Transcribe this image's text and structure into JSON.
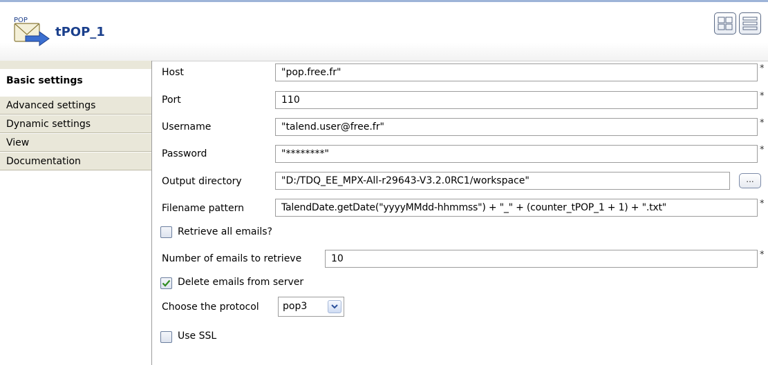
{
  "component": {
    "icon_text": "POP",
    "icon": "pop-mail-icon",
    "title": "tPOP_1"
  },
  "view_buttons": [
    {
      "icon": "grid-view-icon"
    },
    {
      "icon": "list-view-icon"
    }
  ],
  "sidebar": {
    "items": [
      {
        "label": "Basic settings",
        "active": true
      },
      {
        "label": "Advanced settings"
      },
      {
        "label": "Dynamic settings"
      },
      {
        "label": "View"
      },
      {
        "label": "Documentation"
      }
    ]
  },
  "form": {
    "required_mark": "*",
    "host": {
      "label": "Host",
      "value": "\"pop.free.fr\""
    },
    "port": {
      "label": "Port",
      "value": "110"
    },
    "username": {
      "label": "Username",
      "value": "\"talend.user@free.fr\""
    },
    "password": {
      "label": "Password",
      "value": "\"********\""
    },
    "output_directory": {
      "label": "Output directory",
      "value": "\"D:/TDQ_EE_MPX-All-r29643-V3.2.0RC1/workspace\"",
      "browse_label": "..."
    },
    "filename_pattern": {
      "label": "Filename pattern",
      "value": "TalendDate.getDate(\"yyyyMMdd-hhmmss\") + \"_\" + (counter_tPOP_1 + 1) + \".txt\""
    },
    "retrieve_all": {
      "label": "Retrieve all emails?",
      "checked": false
    },
    "number_of_emails": {
      "label": "Number of emails to retrieve",
      "value": "10"
    },
    "delete_emails": {
      "label": "Delete emails from server",
      "checked": true
    },
    "protocol": {
      "label": "Choose the protocol",
      "value": "pop3"
    },
    "use_ssl": {
      "label": "Use SSL",
      "checked": false
    }
  },
  "colors": {
    "title": "#1a3f8c",
    "sidebar_bg": "#e9e7d9",
    "check_mark": "#2e8b1e"
  }
}
